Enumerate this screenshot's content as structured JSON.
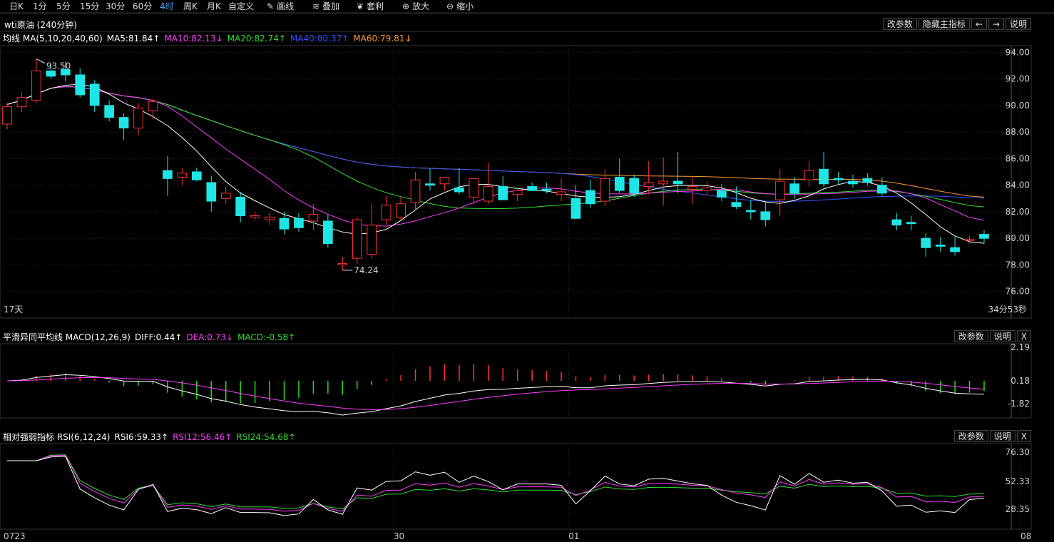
{
  "toolbar": {
    "periods": [
      {
        "label": "日K",
        "active": false
      },
      {
        "label": "1分",
        "active": false
      },
      {
        "label": "5分",
        "active": false
      },
      {
        "label": "15分",
        "active": false
      },
      {
        "label": "30分",
        "active": false
      },
      {
        "label": "60分",
        "active": false
      },
      {
        "label": "4时",
        "active": true
      },
      {
        "label": "周K",
        "active": false
      },
      {
        "label": "月K",
        "active": false
      },
      {
        "label": "自定义",
        "active": false
      }
    ],
    "tools": [
      {
        "label": "画线",
        "icon": "pencil-icon",
        "glyph": "✎"
      },
      {
        "label": "叠加",
        "icon": "database-icon",
        "glyph": "≋"
      },
      {
        "label": "套利",
        "icon": "money-bag-icon",
        "glyph": "❦"
      },
      {
        "label": "放大",
        "icon": "zoom-in-icon",
        "glyph": "⊕"
      },
      {
        "label": "缩小",
        "icon": "zoom-out-icon",
        "glyph": "⊖"
      }
    ]
  },
  "header": {
    "title": "wti原油 (240分钟)",
    "buttons": [
      "改参数",
      "隐藏主指标",
      "←",
      "→",
      "说明"
    ]
  },
  "main_legend": {
    "name": "均线 MA(5,10,20,40,60)",
    "items": [
      {
        "text": "MA5:81.84↑",
        "color": "#ffffff"
      },
      {
        "text": "MA10:82.13↓",
        "color": "#ff3cff"
      },
      {
        "text": "MA20:82.74↑",
        "color": "#33dd33"
      },
      {
        "text": "MA40:80.37↑",
        "color": "#3355ff"
      },
      {
        "text": "MA60:79.81↓",
        "color": "#ff9933"
      }
    ]
  },
  "main_chart": {
    "y_ticks": [
      "94.00",
      "92.00",
      "90.00",
      "88.00",
      "86.00",
      "84.00",
      "82.00",
      "80.00",
      "78.00",
      "76.00"
    ],
    "x_ticks": [
      {
        "label": "0723",
        "index": 0
      },
      {
        "label": "30",
        "index": 27
      },
      {
        "label": "01",
        "index": 39
      },
      {
        "label": "08",
        "index": 70
      }
    ],
    "high_label": "93.50",
    "low_label": "74.24",
    "left_note": "17天",
    "right_note": "34分53秒"
  },
  "macd": {
    "legend_name": "平滑异同平均线 MACD(12,26,9)",
    "items": [
      {
        "text": "DIFF:0.44↑",
        "color": "#ffffff"
      },
      {
        "text": "DEA:0.73↓",
        "color": "#ff3cff"
      },
      {
        "text": "MACD:-0.58↑",
        "color": "#33dd33"
      }
    ],
    "buttons": [
      "改参数",
      "说明",
      "X"
    ],
    "y_ticks": [
      "2.19",
      "0.18",
      "-1.82"
    ]
  },
  "rsi": {
    "legend_name": "相对强弱指标 RSI(6,12,24)",
    "items": [
      {
        "text": "RSI6:59.33↑",
        "color": "#ffffff"
      },
      {
        "text": "RSI12:56.46↑",
        "color": "#ff3cff"
      },
      {
        "text": "RSI24:54.68↑",
        "color": "#33dd33"
      }
    ],
    "buttons": [
      "改参数",
      "说明",
      "X"
    ],
    "y_ticks": [
      "76.30",
      "52.33",
      "28.35"
    ]
  },
  "chart_data": {
    "type": "candlestick",
    "title": "wti原油 (240分钟)",
    "ylim": [
      74,
      94.5
    ],
    "x_ticks": [
      "0723",
      "30",
      "01",
      "08"
    ],
    "ohlc": [
      [
        88.6,
        90.2,
        88.2,
        89.9
      ],
      [
        89.9,
        91.0,
        89.5,
        90.6
      ],
      [
        90.4,
        93.5,
        90.2,
        92.6
      ],
      [
        92.6,
        93.1,
        92.0,
        92.2
      ],
      [
        92.7,
        93.3,
        91.8,
        92.3
      ],
      [
        92.3,
        92.8,
        90.6,
        90.8
      ],
      [
        91.6,
        91.9,
        89.5,
        90.0
      ],
      [
        90.0,
        90.4,
        88.8,
        89.1
      ],
      [
        89.1,
        89.4,
        87.4,
        88.3
      ],
      [
        88.3,
        90.2,
        87.8,
        89.8
      ],
      [
        89.6,
        90.5,
        89.0,
        90.3
      ],
      [
        85.1,
        86.2,
        83.2,
        84.5
      ],
      [
        84.6,
        85.3,
        84.0,
        84.9
      ],
      [
        85.0,
        85.3,
        84.3,
        84.4
      ],
      [
        84.2,
        84.7,
        82.0,
        82.8
      ],
      [
        83.0,
        83.9,
        82.6,
        83.4
      ],
      [
        83.1,
        83.5,
        81.2,
        81.7
      ],
      [
        81.6,
        82.0,
        81.4,
        81.7
      ],
      [
        81.4,
        81.9,
        81.0,
        81.6
      ],
      [
        81.5,
        82.0,
        80.3,
        80.7
      ],
      [
        81.5,
        81.9,
        80.5,
        80.8
      ],
      [
        81.3,
        82.6,
        80.6,
        81.8
      ],
      [
        81.3,
        81.8,
        79.3,
        79.6
      ],
      [
        78.0,
        78.6,
        77.6,
        78.1
      ],
      [
        78.5,
        81.6,
        78.1,
        81.4
      ],
      [
        78.8,
        82.6,
        78.5,
        81.0
      ],
      [
        81.4,
        83.2,
        81.0,
        82.5
      ],
      [
        81.6,
        83.1,
        81.4,
        82.6
      ],
      [
        82.7,
        85.0,
        82.2,
        84.4
      ],
      [
        84.1,
        85.3,
        83.6,
        84.0
      ],
      [
        84.1,
        84.5,
        83.6,
        84.6
      ],
      [
        83.8,
        85.3,
        83.3,
        83.5
      ],
      [
        83.1,
        84.2,
        82.6,
        84.5
      ],
      [
        82.8,
        85.7,
        82.6,
        83.9
      ],
      [
        83.9,
        84.7,
        82.9,
        82.9
      ],
      [
        83.3,
        83.8,
        82.8,
        83.6
      ],
      [
        83.9,
        84.2,
        83.6,
        83.6
      ],
      [
        83.7,
        84.2,
        83.4,
        83.6
      ],
      [
        83.3,
        84.5,
        82.8,
        83.5
      ],
      [
        83.0,
        84.0,
        82.0,
        81.5
      ],
      [
        83.6,
        84.4,
        82.3,
        82.6
      ],
      [
        82.8,
        85.2,
        82.4,
        84.5
      ],
      [
        84.6,
        86.0,
        83.4,
        83.6
      ],
      [
        84.5,
        84.8,
        83.1,
        83.4
      ],
      [
        83.9,
        85.8,
        83.3,
        84.2
      ],
      [
        84.1,
        86.1,
        82.5,
        84.3
      ],
      [
        84.3,
        86.5,
        83.4,
        84.1
      ],
      [
        83.7,
        84.6,
        82.6,
        83.9
      ],
      [
        83.6,
        84.3,
        83.2,
        83.8
      ],
      [
        83.6,
        84.1,
        82.8,
        83.1
      ],
      [
        82.7,
        83.9,
        82.2,
        82.4
      ],
      [
        82.1,
        82.9,
        81.4,
        82.0
      ],
      [
        82.0,
        82.7,
        80.9,
        81.4
      ],
      [
        82.9,
        85.2,
        81.7,
        84.3
      ],
      [
        84.1,
        84.6,
        83.0,
        83.4
      ],
      [
        84.4,
        85.8,
        83.9,
        85.1
      ],
      [
        85.2,
        86.5,
        83.9,
        84.1
      ],
      [
        84.5,
        85.0,
        84.1,
        84.4
      ],
      [
        84.3,
        84.8,
        83.8,
        84.1
      ],
      [
        84.5,
        84.9,
        84.0,
        84.2
      ],
      [
        84.0,
        84.6,
        83.2,
        83.4
      ],
      [
        81.4,
        81.9,
        80.6,
        81.0
      ],
      [
        81.2,
        81.7,
        80.6,
        81.1
      ],
      [
        80.0,
        80.4,
        78.6,
        79.3
      ],
      [
        79.5,
        80.1,
        79.0,
        79.4
      ],
      [
        79.3,
        80.2,
        78.7,
        79.0
      ],
      [
        79.9,
        80.2,
        79.6,
        79.9
      ],
      [
        80.3,
        80.6,
        79.6,
        80.0
      ]
    ],
    "ma5": [],
    "ma10": [],
    "ma20": [],
    "ma40": [],
    "ma60": []
  }
}
